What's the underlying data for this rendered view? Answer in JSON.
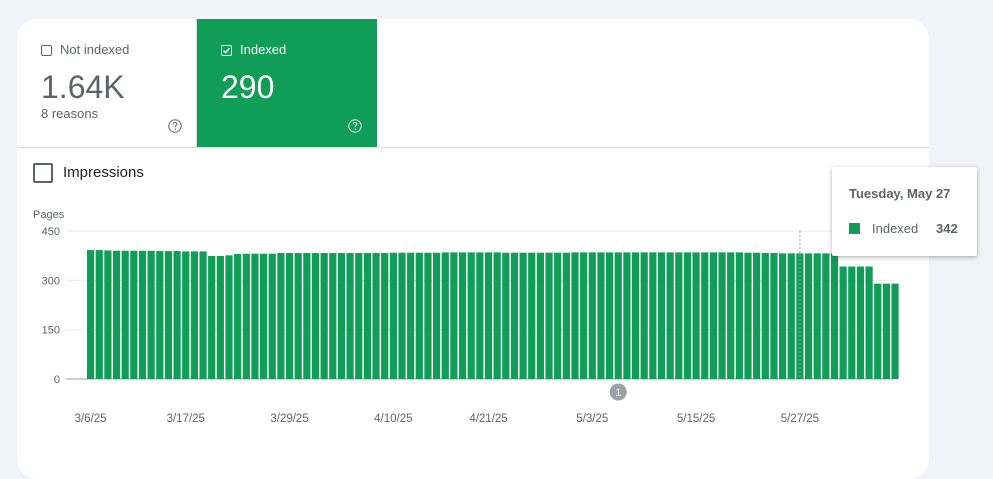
{
  "tiles": {
    "not_indexed": {
      "label": "Not indexed",
      "value": "1.64K",
      "sub": "8 reasons",
      "checked": false
    },
    "indexed": {
      "label": "Indexed",
      "value": "290",
      "checked": true
    }
  },
  "impressions": {
    "label": "Impressions",
    "checked": false
  },
  "chart_data": {
    "type": "bar",
    "ylabel": "Pages",
    "yticks": [
      "0",
      "150",
      "300",
      "450"
    ],
    "ylim": [
      0,
      450
    ],
    "xtick_labels": [
      "3/6/25",
      "3/17/25",
      "3/29/25",
      "4/10/25",
      "4/21/25",
      "5/3/25",
      "5/15/25",
      "5/27/25"
    ],
    "xtick_indices": [
      0,
      11,
      23,
      35,
      46,
      58,
      70,
      82
    ],
    "series": [
      {
        "name": "Indexed",
        "color": "#0f9d58",
        "values": [
          392,
          392,
          391,
          390,
          390,
          390,
          390,
          390,
          389,
          389,
          389,
          388,
          388,
          388,
          374,
          374,
          376,
          380,
          381,
          381,
          381,
          381,
          383,
          383,
          383,
          383,
          383,
          383,
          383,
          383,
          383,
          383,
          383,
          383,
          383,
          384,
          384,
          384,
          384,
          384,
          384,
          385,
          385,
          385,
          385,
          385,
          385,
          385,
          384,
          384,
          384,
          384,
          384,
          384,
          384,
          384,
          385,
          385,
          385,
          385,
          385,
          385,
          385,
          385,
          385,
          385,
          385,
          385,
          385,
          385,
          385,
          385,
          385,
          385,
          385,
          385,
          384,
          384,
          383,
          383,
          382,
          382,
          382,
          382,
          382,
          382,
          382,
          342,
          342,
          342,
          342,
          290,
          290,
          290
        ]
      }
    ],
    "grid": true,
    "annotation": {
      "label": "1",
      "x_index": 61
    },
    "hover_index": 82
  },
  "tooltip": {
    "title": "Tuesday, May 27",
    "series": "Indexed",
    "value": "342"
  },
  "colors": {
    "accent": "#0f9d58",
    "text": "#5f6368",
    "background": "#f1f3f8"
  },
  "icons": {
    "help": "help-circle-icon",
    "check": "checkmark-icon"
  }
}
